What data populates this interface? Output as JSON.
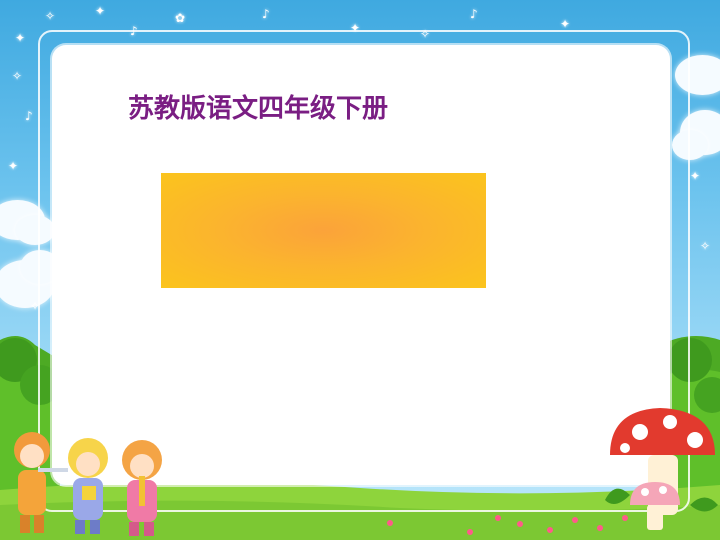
{
  "slide": {
    "title": "苏教版语文四年级下册"
  },
  "colors": {
    "sky": "#3fa9e0",
    "title": "#7a1e83",
    "box_center": "#fba33a",
    "box_edge": "#fbc41d",
    "grass": "#5fbf2a"
  },
  "decorations": {
    "left_illustration": "three-cartoon-kids-playing-instruments",
    "right_illustration": "red-and-white-mushrooms"
  }
}
